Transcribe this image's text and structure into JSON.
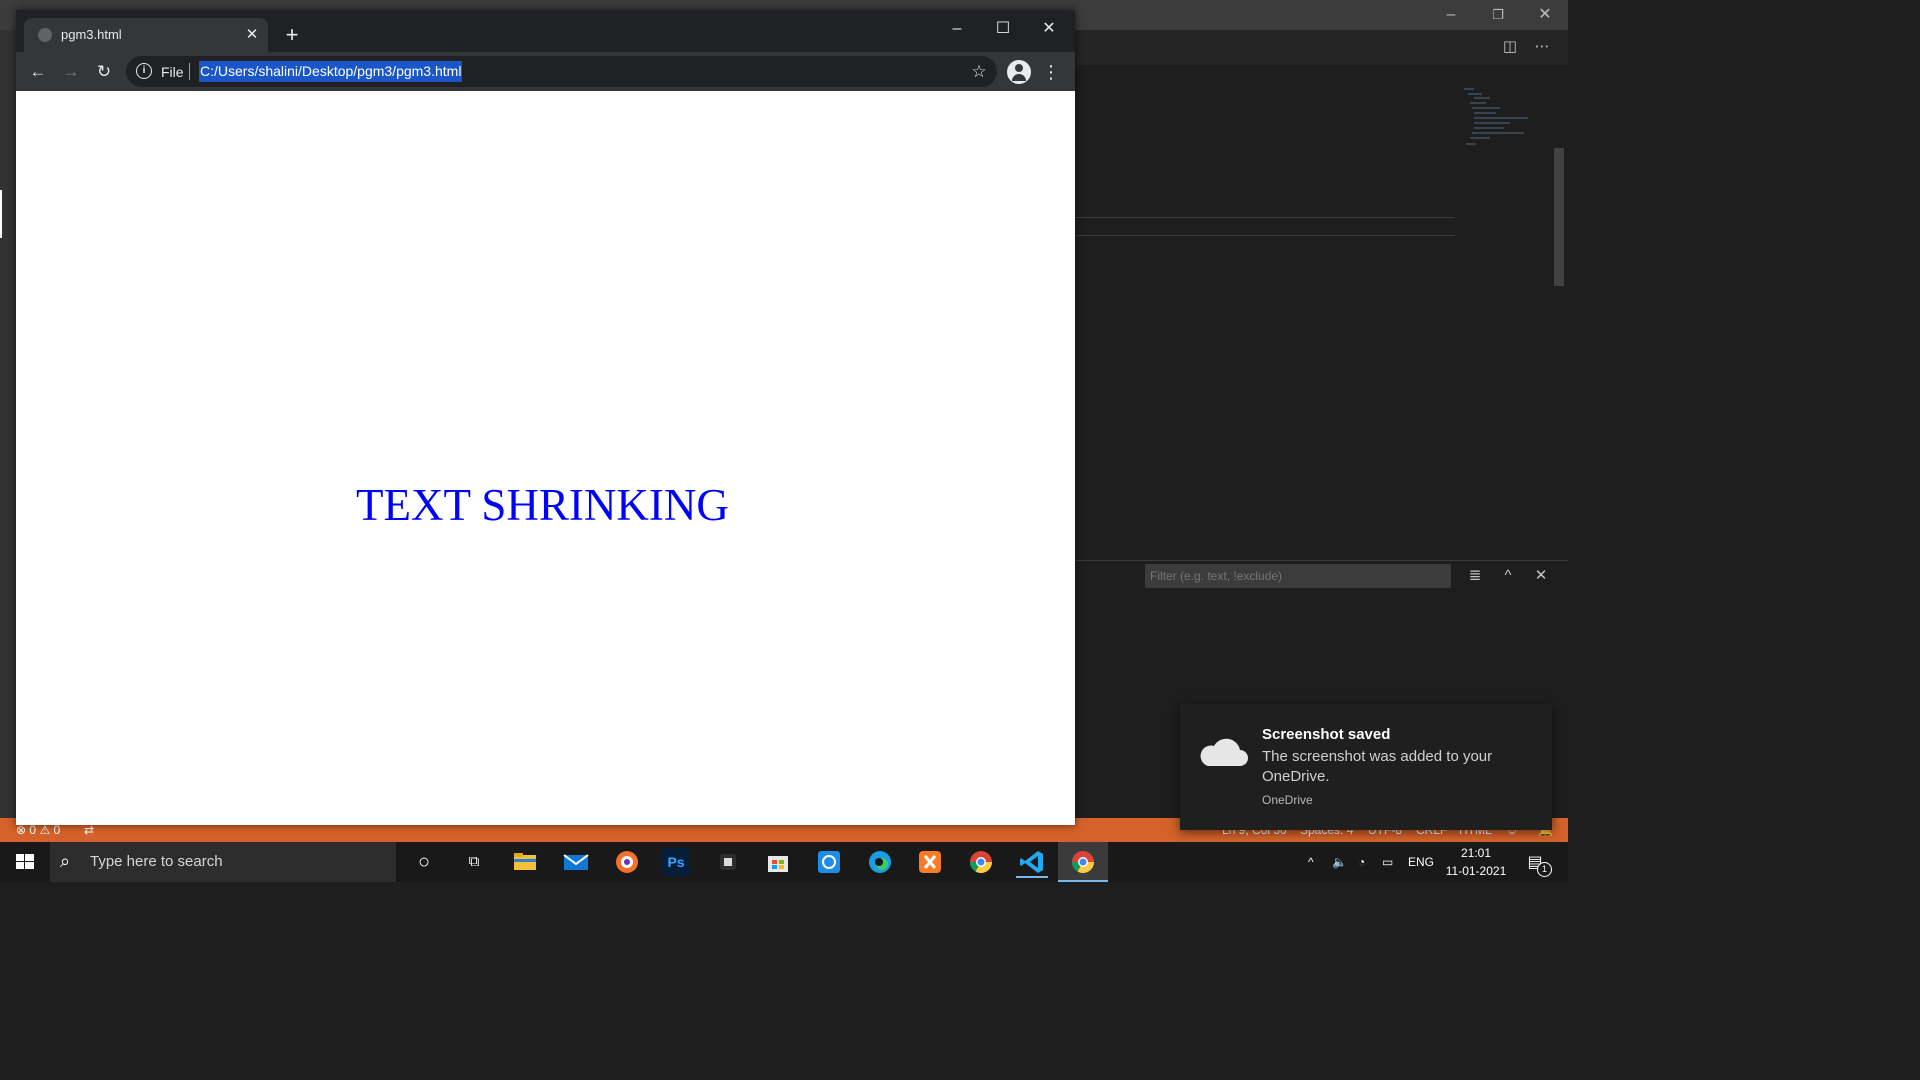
{
  "browser": {
    "tab_title": "pgm3.html",
    "address_prefix": "File",
    "url": "C:/Users/shalini/Desktop/pgm3/pgm3.html"
  },
  "page": {
    "heading": "TEXT SHRINKING",
    "heading_color": "#0000ff"
  },
  "vscode": {
    "filter_placeholder": "Filter (e.g. text, !exclude)",
    "status": {
      "errors": "0",
      "warnings": "0",
      "position": "Ln 9, Col 30",
      "spaces": "Spaces: 4",
      "encoding": "UTF-8",
      "eol": "CRLF",
      "language": "HTML"
    },
    "statusbar_color": "#d4622a"
  },
  "toast": {
    "title": "Screenshot saved",
    "message": "The screenshot was added to your OneDrive.",
    "app": "OneDrive"
  },
  "taskbar": {
    "search_placeholder": "Type here to search",
    "apps": [
      {
        "name": "cortana-icon",
        "glyph": "○"
      },
      {
        "name": "task-view-icon",
        "glyph": "⧉"
      },
      {
        "name": "file-explorer-icon",
        "glyph": "▬"
      },
      {
        "name": "mail-icon",
        "glyph": "✉"
      },
      {
        "name": "brave-browser-icon",
        "glyph": "◆"
      },
      {
        "name": "photoshop-icon",
        "glyph": "Ps"
      },
      {
        "name": "app-icon",
        "glyph": "◙"
      },
      {
        "name": "store-icon",
        "glyph": "▦"
      },
      {
        "name": "sync-app-icon",
        "glyph": "↻"
      },
      {
        "name": "edge-icon",
        "glyph": "e"
      },
      {
        "name": "xampp-icon",
        "glyph": "✕"
      },
      {
        "name": "chrome-icon",
        "glyph": "●"
      },
      {
        "name": "vscode-icon",
        "glyph": "❮❯"
      },
      {
        "name": "chrome-active-icon",
        "glyph": "●"
      }
    ],
    "language": "ENG",
    "time": "21:01",
    "date": "11-01-2021",
    "notification_count": "1"
  }
}
